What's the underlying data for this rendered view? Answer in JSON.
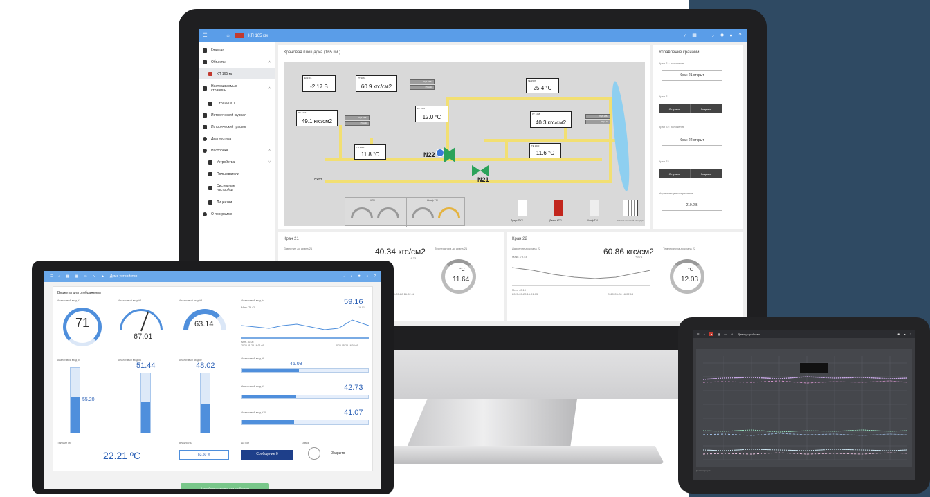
{
  "monitor": {
    "topbar": {
      "title": "КП 165 км"
    },
    "sidebar": {
      "items": [
        {
          "label": "Главная"
        },
        {
          "label": "Объекты"
        },
        {
          "label": "КП 165 км"
        },
        {
          "label": "Настраиваемые страницы"
        },
        {
          "label": "Страница 1"
        },
        {
          "label": "Исторический журнал"
        },
        {
          "label": "Исторический график"
        },
        {
          "label": "Диагностика"
        },
        {
          "label": "Настройки"
        },
        {
          "label": "Устройства"
        },
        {
          "label": "Пользователи"
        },
        {
          "label": "Системные настройки"
        },
        {
          "label": "Лицензии"
        },
        {
          "label": "О программе"
        }
      ]
    },
    "scheme": {
      "title": "Крановая площадка (165 км.)",
      "values": {
        "v1": {
          "label": "EI 1315",
          "value": "-2.17 В"
        },
        "v2": {
          "label": "PT 1861",
          "value": "60.9 кгс/см2"
        },
        "v3": {
          "label": "PT 1457",
          "value": "49.1 кгс/см2"
        },
        "v4": {
          "label": "TE 1621",
          "value": "12.0 °С"
        },
        "v5": {
          "label": "TE 1625",
          "value": "11.8 °С"
        },
        "v6": {
          "label": "TE 1587",
          "value": "25.4 °С"
        },
        "v7": {
          "label": "PT 1458",
          "value": "40.3 кгс/см2"
        },
        "v8": {
          "label": "TE 1630",
          "value": "11.6 °С"
        }
      },
      "pqa": [
        "PQA 1853",
        "PQA 1L",
        "PQA 1854",
        "PQA 1L",
        "PQA 1854",
        "PQA 1L"
      ],
      "valve_labels": {
        "n22": "N22",
        "n21": "N21"
      },
      "direction": "Вход",
      "gauges": {
        "g1_title": "КТП",
        "g2_title": "Шкаф ТМ"
      },
      "doors": [
        "Дверь ПКУ",
        "Дверь КТП",
        "Шкаф ТМ",
        "Калитка крановой площадки"
      ]
    },
    "control": {
      "title": "Управление кранами",
      "crane21_state_label": "Кран 21: положение",
      "crane21_state": "Кран 21 открыт",
      "crane21_label": "Кран 21",
      "open": "Открыть",
      "close": "Закрыть",
      "crane22_state_label": "Кран 22: положение",
      "crane22_state": "Кран 22 открыт",
      "crane22_label": "Кран 22",
      "voltage_label": "Управляющее напряжение",
      "voltage": "210.2 В"
    },
    "crane21": {
      "title": "Кран 21",
      "pressure_label": "Давление до крана 21",
      "pressure": "40.34 кгс/см2",
      "pressure_delta": "-4.33",
      "temp_label": "Температура до крана 21",
      "temp_unit": "°С",
      "temp": "11.64",
      "date_to": "2020-05-28 16:02:18"
    },
    "crane22": {
      "title": "Кран 22",
      "pressure_label": "Давление до крана 22",
      "pressure": "60.86 кгс/см2",
      "max": "Макс. 79.44",
      "delta": "+9.74",
      "min": "Мин. 40.10",
      "date_from": "2020-05-28 16:01:03",
      "date_to": "2020-05-28 16:02:18",
      "temp_label": "Температура до крана 22",
      "temp_unit": "°С",
      "temp": "12.03"
    }
  },
  "laptop": {
    "topbar": {
      "title": "Демо устройство"
    },
    "card_title": "Виджеты для отображения",
    "w1": {
      "label": "Аналоговый вход #1",
      "value": "71"
    },
    "w2": {
      "label": "Аналоговый вход #2",
      "value": "67.01"
    },
    "w3": {
      "label": "Аналоговый вход #3",
      "value": "63.14"
    },
    "w4": {
      "label": "Аналоговый вход #4",
      "value": "59.16",
      "max": "Макс. 79.42",
      "delta": "-16.01",
      "min": "Мин. 40.05",
      "date_from": "2020-05-28 16:01:01",
      "date_to": "2020-05-28 16:02:01"
    },
    "w5": {
      "label": "Аналоговый вход #5",
      "value": "55.20",
      "fill": 0.55
    },
    "w6": {
      "label": "Аналоговый вход #6",
      "value": "51.44",
      "fill": 0.51
    },
    "w7": {
      "label": "Аналоговый вход #7",
      "value": "48.02",
      "fill": 0.48
    },
    "w8": {
      "label": "Аналоговый вход #8",
      "value": "45.08",
      "fill": 0.45
    },
    "w9": {
      "label": "Аналоговый вход #9",
      "value": "42.73",
      "fill": 0.43
    },
    "w10": {
      "label": "Аналоговый вход #10",
      "value": "41.07",
      "fill": 0.41
    },
    "temp": {
      "label": "Текущий уат",
      "value": "22.21 ºC"
    },
    "humidity": {
      "label": "Влажность",
      "value": "83.50 %"
    },
    "message": {
      "label": "До пол",
      "value": "Сообщение 0"
    },
    "lock": {
      "label": "Замок",
      "value": "Закрыто"
    },
    "green_button": "Аварийная остановка или сообщение"
  },
  "tablet": {
    "topbar": {
      "title": "Демо устройство"
    },
    "footer": "Демонстрация"
  }
}
